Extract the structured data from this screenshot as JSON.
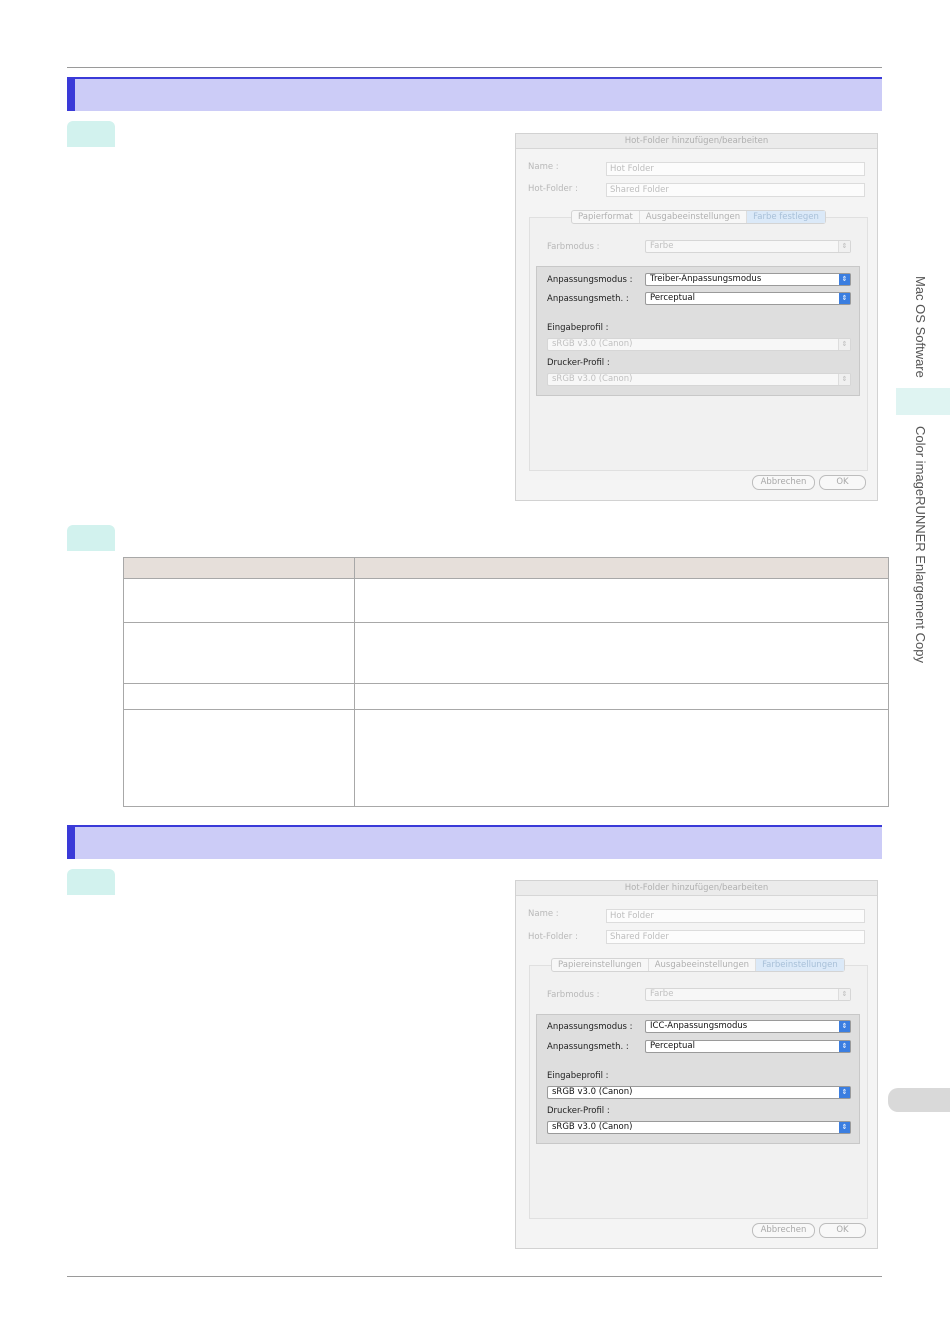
{
  "side_labels": {
    "mac_os_software": "Mac OS Software",
    "color_irc_enlargement": "Color imageRUNNER Enlargement Copy"
  },
  "dialog1": {
    "title": "Hot-Folder hinzufügen/bearbeiten",
    "name_label": "Name :",
    "name_value": "Hot Folder",
    "hotfolder_label": "Hot-Folder :",
    "hotfolder_value": "Shared Folder",
    "tabs": [
      "Papierformat",
      "Ausgabeeinstellungen",
      "Farbe festlegen"
    ],
    "selected_tab": "Farbe festlegen",
    "farbmodus_label": "Farbmodus :",
    "farbmodus_value": "Farbe",
    "anpassungsmodus_label": "Anpassungsmodus :",
    "anpassungsmodus_value": "Treiber-Anpassungsmodus",
    "anpassungsmeth_label": "Anpassungsmeth. :",
    "anpassungsmeth_value": "Perceptual",
    "eingabeprofil_label": "Eingabeprofil :",
    "eingabeprofil_value": "sRGB v3.0 (Canon)",
    "druckerprofil_label": "Drucker-Profil :",
    "druckerprofil_value": "sRGB v3.0 (Canon)",
    "cancel_label": "Abbrechen",
    "ok_label": "OK"
  },
  "dialog2": {
    "title": "Hot-Folder hinzufügen/bearbeiten",
    "name_label": "Name :",
    "name_value": "Hot Folder",
    "hotfolder_label": "Hot-Folder :",
    "hotfolder_value": "Shared Folder",
    "tabs": [
      "Papiereinstellungen",
      "Ausgabeeinstellungen",
      "Farbeinstellungen"
    ],
    "selected_tab": "Farbeinstellungen",
    "farbmodus_label": "Farbmodus :",
    "farbmodus_value": "Farbe",
    "anpassungsmodus_label": "Anpassungsmodus :",
    "anpassungsmodus_value": "ICC-Anpassungsmodus",
    "anpassungsmeth_label": "Anpassungsmeth. :",
    "anpassungsmeth_value": "Perceptual",
    "eingabeprofil_label": "Eingabeprofil :",
    "eingabeprofil_value": "sRGB v3.0 (Canon)",
    "druckerprofil_label": "Drucker-Profil :",
    "druckerprofil_value": "sRGB v3.0 (Canon)",
    "cancel_label": "Abbrechen",
    "ok_label": "OK"
  },
  "colors": {
    "section_bar": "#ccccf7",
    "section_accent": "#3a3ad8",
    "step_tab": "#d2f2ee",
    "table_header": "#e6dfda",
    "popup_arrow": "#3b7ee0"
  },
  "icons": {
    "popup_arrow": "popup-updown-arrow-icon"
  }
}
